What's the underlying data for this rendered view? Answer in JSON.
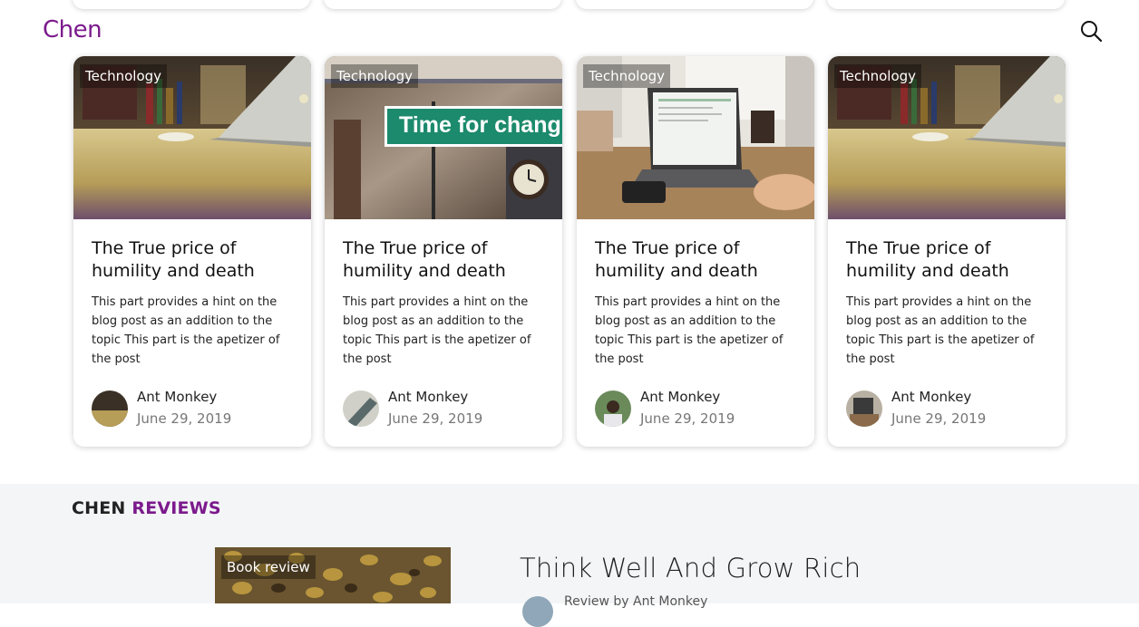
{
  "header": {
    "logo": "Chen"
  },
  "cards": [
    {
      "tag": "Technology",
      "title": "The True price of humility and death",
      "description": "This part provides a hint on the blog post as an addition to the topic This part is the apetizer of the post",
      "author": "Ant Monkey",
      "date": "June 29, 2019"
    },
    {
      "tag": "Technology",
      "title": "The True price of humility and death",
      "description": "This part provides a hint on the blog post as an addition to the topic This part is the apetizer of the post",
      "author": "Ant Monkey",
      "date": "June 29, 2019",
      "sign_text": "Time for chang"
    },
    {
      "tag": "Technology",
      "title": "The True price of humility and death",
      "description": "This part provides a hint on the blog post as an addition to the topic This part is the apetizer of the post",
      "author": "Ant Monkey",
      "date": "June 29, 2019"
    },
    {
      "tag": "Technology",
      "title": "The True price of humility and death",
      "description": "This part provides a hint on the blog post as an addition to the topic This part is the apetizer of the post",
      "author": "Ant Monkey",
      "date": "June 29, 2019"
    }
  ],
  "reviews": {
    "heading_dark": "CHEN",
    "heading_accent": "REVIEWS",
    "tag": "Book review",
    "title": "Think Well And Grow Rich",
    "by": "Review by Ant Monkey"
  },
  "colors": {
    "brand": "#7b1a8c",
    "sign_green": "#1c8a6c",
    "section_bg": "#f4f5f7"
  }
}
